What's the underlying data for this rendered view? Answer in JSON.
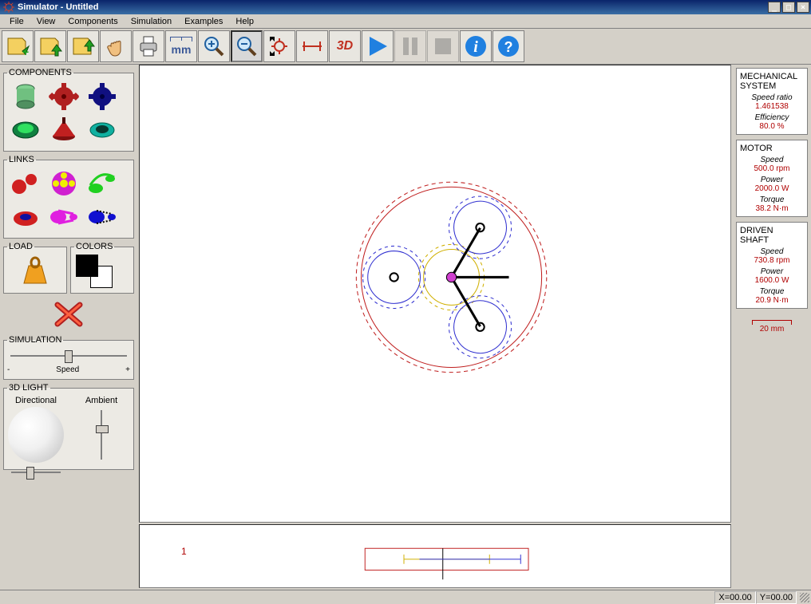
{
  "window": {
    "title": "Simulator - Untitled"
  },
  "menu": [
    "File",
    "View",
    "Components",
    "Simulation",
    "Examples",
    "Help"
  ],
  "toolbar": {
    "unit_label": "mm",
    "threeD_label": "3D"
  },
  "left": {
    "components_title": "COMPONENTS",
    "links_title": "LINKS",
    "load_title": "LOAD",
    "colors_title": "COLORS",
    "simulation_title": "SIMULATION",
    "speed_label": "Speed",
    "minus": "-",
    "plus": "+",
    "threeDlight_title": "3D LIGHT",
    "directional_label": "Directional",
    "ambient_label": "Ambient"
  },
  "right": {
    "mech_title": "MECHANICAL SYSTEM",
    "speedratio_lbl": "Speed ratio",
    "speedratio_val": "1.461538",
    "efficiency_lbl": "Efficiency",
    "efficiency_val": "80.0 %",
    "motor_title": "MOTOR",
    "motor_speed_lbl": "Speed",
    "motor_speed_val": "500.0 rpm",
    "motor_power_lbl": "Power",
    "motor_power_val": "2000.0 W",
    "motor_torque_lbl": "Torque",
    "motor_torque_val": "38.2 N·m",
    "driven_title": "DRIVEN SHAFT",
    "driven_speed_lbl": "Speed",
    "driven_speed_val": "730.8 rpm",
    "driven_power_lbl": "Power",
    "driven_power_val": "1600.0 W",
    "driven_torque_lbl": "Torque",
    "driven_torque_val": "20.9 N·m",
    "scale_label": "20 mm"
  },
  "timeline": {
    "index": "1"
  },
  "status": {
    "x": "X=00.00",
    "y": "Y=00.00"
  }
}
